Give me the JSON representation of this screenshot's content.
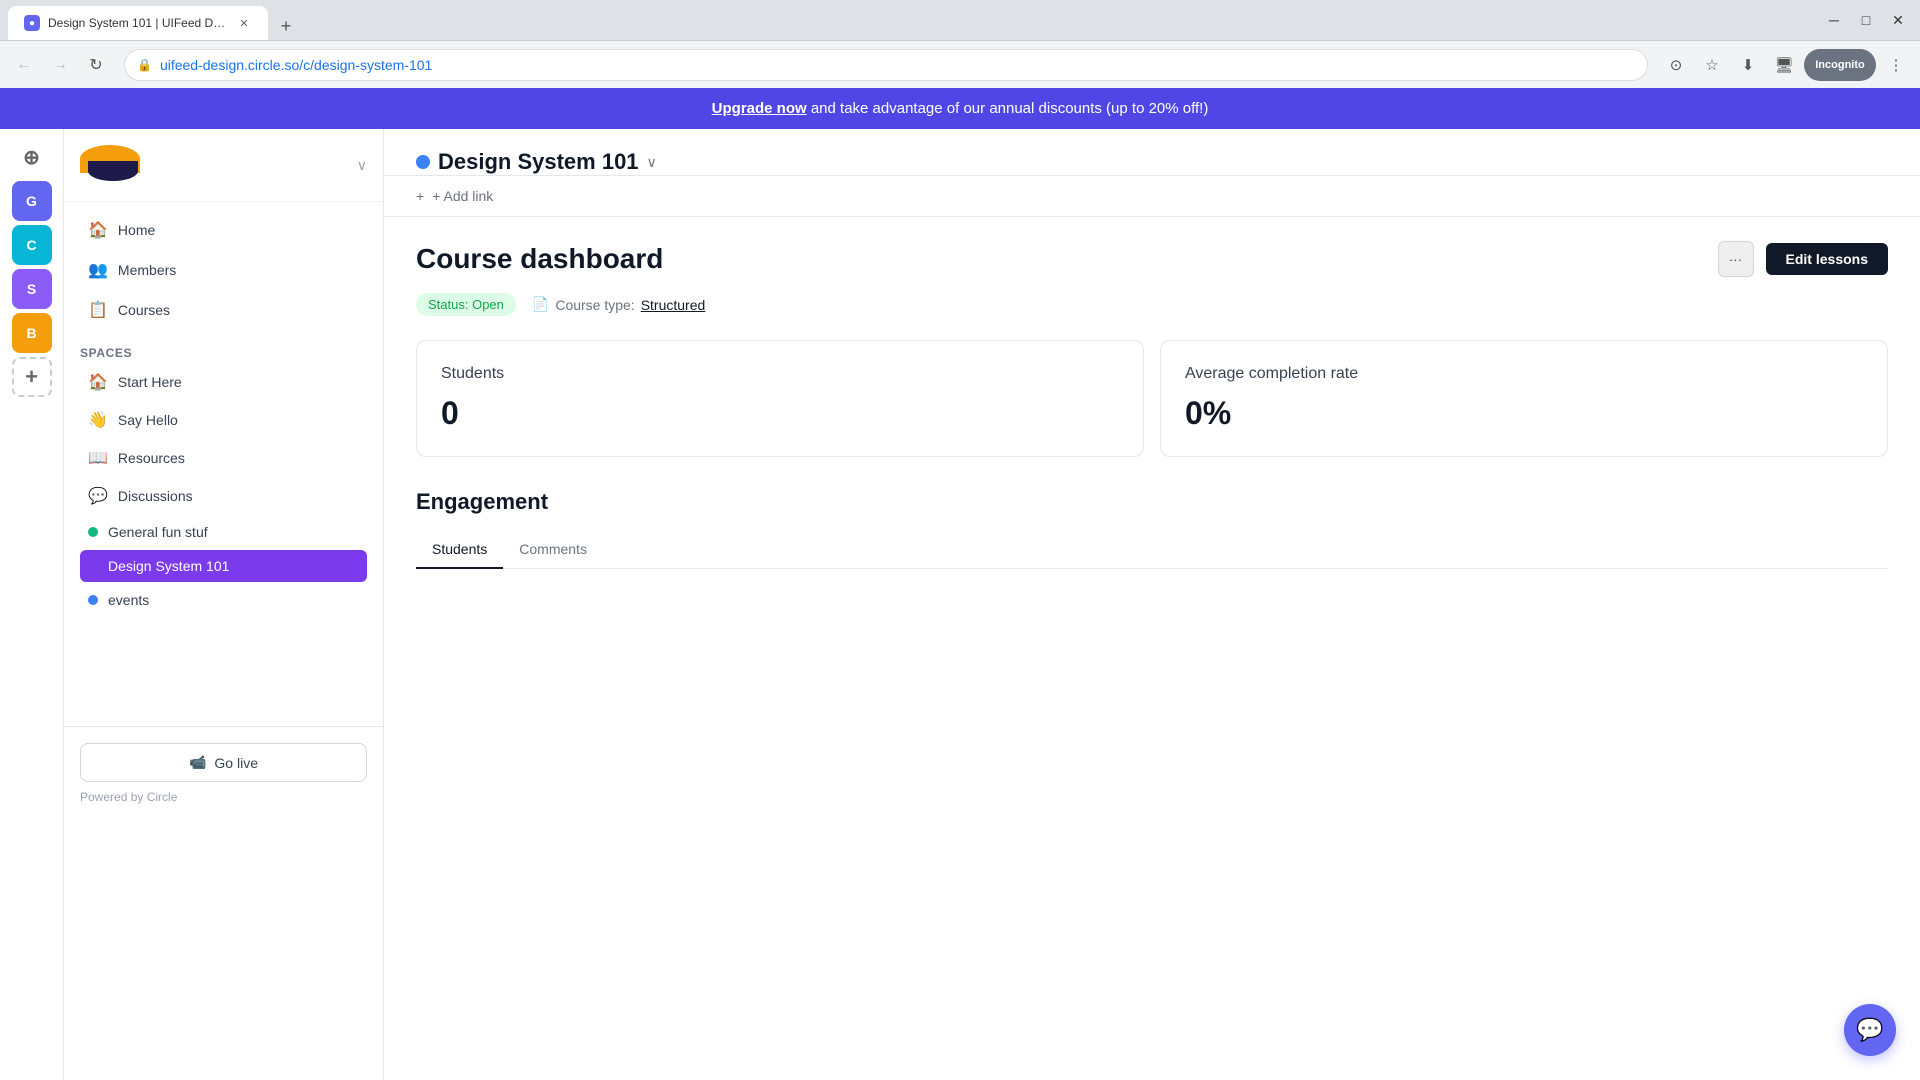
{
  "browser": {
    "tab_title": "Design System 101 | UIFeed Des...",
    "url_prefix": "uifeed-design.circle.so",
    "url_path": "/c/design-system-101",
    "new_tab_label": "+",
    "incognito_label": "Incognito"
  },
  "banner": {
    "text_before": " and take advantage of our annual discounts (up to 20% off!)",
    "link_text": "Upgrade now"
  },
  "sidebar": {
    "nav_items": [
      {
        "label": "Home",
        "icon": "🏠"
      },
      {
        "label": "Members",
        "icon": "👥"
      },
      {
        "label": "Courses",
        "icon": "📋"
      }
    ],
    "spaces_label": "Spaces",
    "space_items": [
      {
        "label": "Start Here",
        "icon": "🏠",
        "dot": null
      },
      {
        "label": "Say Hello",
        "icon": "👋",
        "dot": null
      },
      {
        "label": "Resources",
        "icon": "📖",
        "dot": null
      },
      {
        "label": "Discussions",
        "icon": "💬",
        "dot": null
      },
      {
        "label": "General fun stuf",
        "icon": null,
        "dot": "green"
      },
      {
        "label": "Design System 101",
        "icon": null,
        "dot": "purple",
        "active": true
      },
      {
        "label": "events",
        "icon": null,
        "dot": "blue"
      }
    ],
    "go_live_label": "Go live",
    "powered_by": "Powered by Circle"
  },
  "rail": {
    "items": [
      {
        "label": "G",
        "class": "rail-g"
      },
      {
        "label": "C",
        "class": "rail-c"
      },
      {
        "label": "S",
        "class": "rail-s"
      },
      {
        "label": "B",
        "class": "rail-b"
      }
    ],
    "add_label": "+"
  },
  "course": {
    "title": "Design System 101",
    "add_link_label": "+ Add link",
    "dashboard_title": "Course dashboard",
    "status_label": "Status: Open",
    "course_type_prefix": "Course type:",
    "course_type_value": "Structured",
    "more_btn_label": "···",
    "edit_lessons_label": "Edit lessons",
    "students_label": "Students",
    "students_value": "0",
    "completion_label": "Average completion rate",
    "completion_value": "0%",
    "engagement_title": "Engagement",
    "tabs": [
      {
        "label": "Students",
        "active": true
      },
      {
        "label": "Comments",
        "active": false
      }
    ]
  }
}
